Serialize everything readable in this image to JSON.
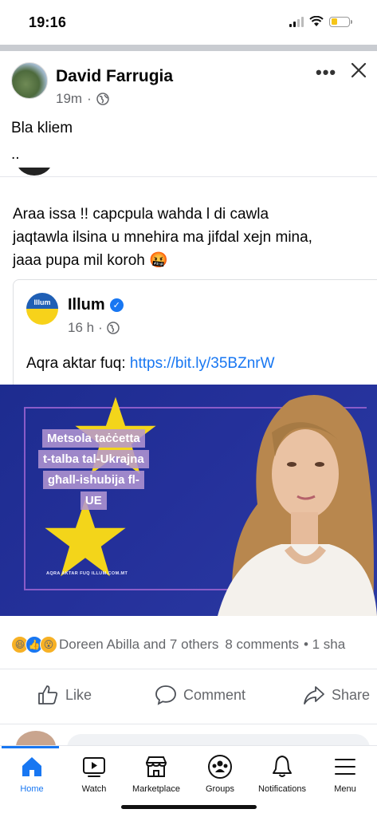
{
  "status": {
    "time": "19:16"
  },
  "post": {
    "author": "David Farrugia",
    "time": "19m",
    "text": "Bla kliem",
    "dots": ".."
  },
  "shared": {
    "text_lines": [
      "Araa issa !!  capcpula wahda  l di cawla",
      "jaqtawla ilsina u mnehira ma jifdal xejn mina,",
      "jaaa pupa mil koroh 🤬"
    ],
    "quoted": {
      "page_name": "Illum",
      "logo_text": "Illum",
      "time": "16 h",
      "read_more_prefix": "Aqra aktar fuq: ",
      "link": "https://bit.ly/35BZnrW"
    },
    "image": {
      "headline_lines": [
        "Metsola taċċetta",
        "t-talba tal-Ukrajna",
        "għall-ishubija fl-",
        "UE"
      ],
      "url_caption": "AQRA AKTAR FUQ ILLUM.COM.MT"
    }
  },
  "reactions": {
    "summary": "Doreen Abilla and 7 others",
    "comments": "8 comments",
    "shares": "• 1 sha"
  },
  "actions": {
    "like": "Like",
    "comment": "Comment",
    "share": "Share"
  },
  "tabs": [
    {
      "label": "Home",
      "icon": "home-icon",
      "active": true
    },
    {
      "label": "Watch",
      "icon": "watch-icon"
    },
    {
      "label": "Marketplace",
      "icon": "marketplace-icon"
    },
    {
      "label": "Groups",
      "icon": "groups-icon"
    },
    {
      "label": "Notifications",
      "icon": "bell-icon"
    },
    {
      "label": "Menu",
      "icon": "menu-icon"
    }
  ],
  "colors": {
    "accent": "#1877f2",
    "secondary_text": "#65676b",
    "image_bg": "#24309a"
  }
}
